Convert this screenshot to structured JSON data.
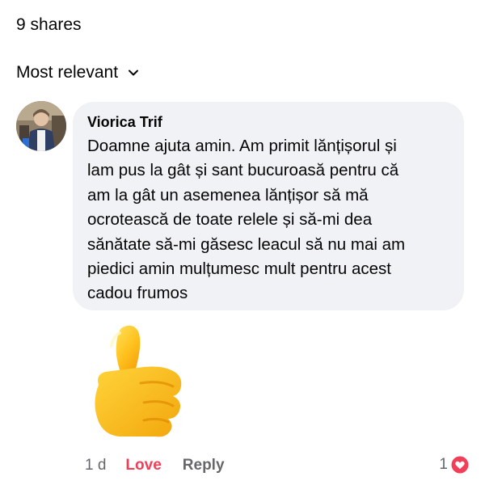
{
  "header": {
    "shares_label": "9 shares"
  },
  "sort": {
    "label": "Most relevant",
    "icon": "chevron-down-icon"
  },
  "comment": {
    "author": "Viorica Trif",
    "text": "Doamne ajuta amin. Am primit  lănțișorul și\nlam pus la  gât și sant bucuroasă pentru că\nam la gât un asemenea  lănțișor să mă\nocrotească de toate relele și să-mi dea\nsănătate să-mi găsesc leacul să nu mai am\npiedici amin mulțumesc mult pentru acest\ncadou frumos",
    "sticker": "thumbs-up-icon",
    "time": "1 d",
    "love_label": "Love",
    "reply_label": "Reply",
    "reaction_count": "1",
    "reaction_icon": "heart-icon"
  },
  "colors": {
    "bubble": "#f0f2f5",
    "love": "#f33e58",
    "secondary_text": "#65676b",
    "heart": "#f33e58"
  }
}
